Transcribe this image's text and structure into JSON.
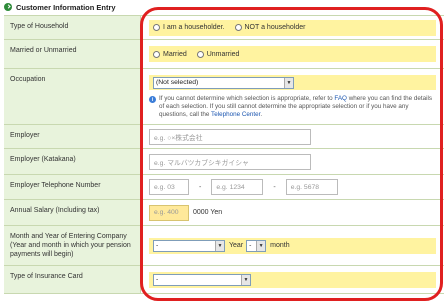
{
  "header": {
    "title": "Customer Information Entry"
  },
  "household": {
    "label": "Type of Household",
    "options": [
      "I am a householder.",
      "NOT a householder"
    ]
  },
  "marital": {
    "label": "Married or Unmarried",
    "options": [
      "Married",
      "Unmarried"
    ]
  },
  "occupation": {
    "label": "Occupation",
    "selected": "(Not selected)",
    "info_pre": "If you cannot determine which selection is appropriate, refer to ",
    "faq_link": "FAQ",
    "info_mid": " where you can find the details of each selection. If you still cannot determine the appropriate selection or if you have any questions, call the ",
    "phone_link": "Telephone Center",
    "info_post": "."
  },
  "employer": {
    "label": "Employer",
    "placeholder": "e.g. ○×株式会社"
  },
  "employer_kana": {
    "label": "Employer (Katakana)",
    "placeholder": "e.g. マルバツカブシキガイシャ"
  },
  "employer_phone": {
    "label": "Employer Telephone Number",
    "p1": "e.g. 03",
    "p2": "e.g. 1234",
    "p3": "e.g. 5678",
    "sep": "-"
  },
  "salary": {
    "label": "Annual Salary (Including tax)",
    "placeholder": "e.g. 400",
    "unit": "0000 Yen"
  },
  "entering": {
    "label": "Month and Year of Entering Company (Year and month in which your pension payments will begin)",
    "year_value": "-",
    "year_label": "Year",
    "month_value": "-",
    "month_label": "month"
  },
  "insurance": {
    "label": "Type of Insurance Card",
    "value": "-"
  },
  "colors": {
    "highlight_frame": "#e02020",
    "label_bg": "#e8f3dc",
    "band": "#fff3a0",
    "accent": "#2e8b3a"
  }
}
